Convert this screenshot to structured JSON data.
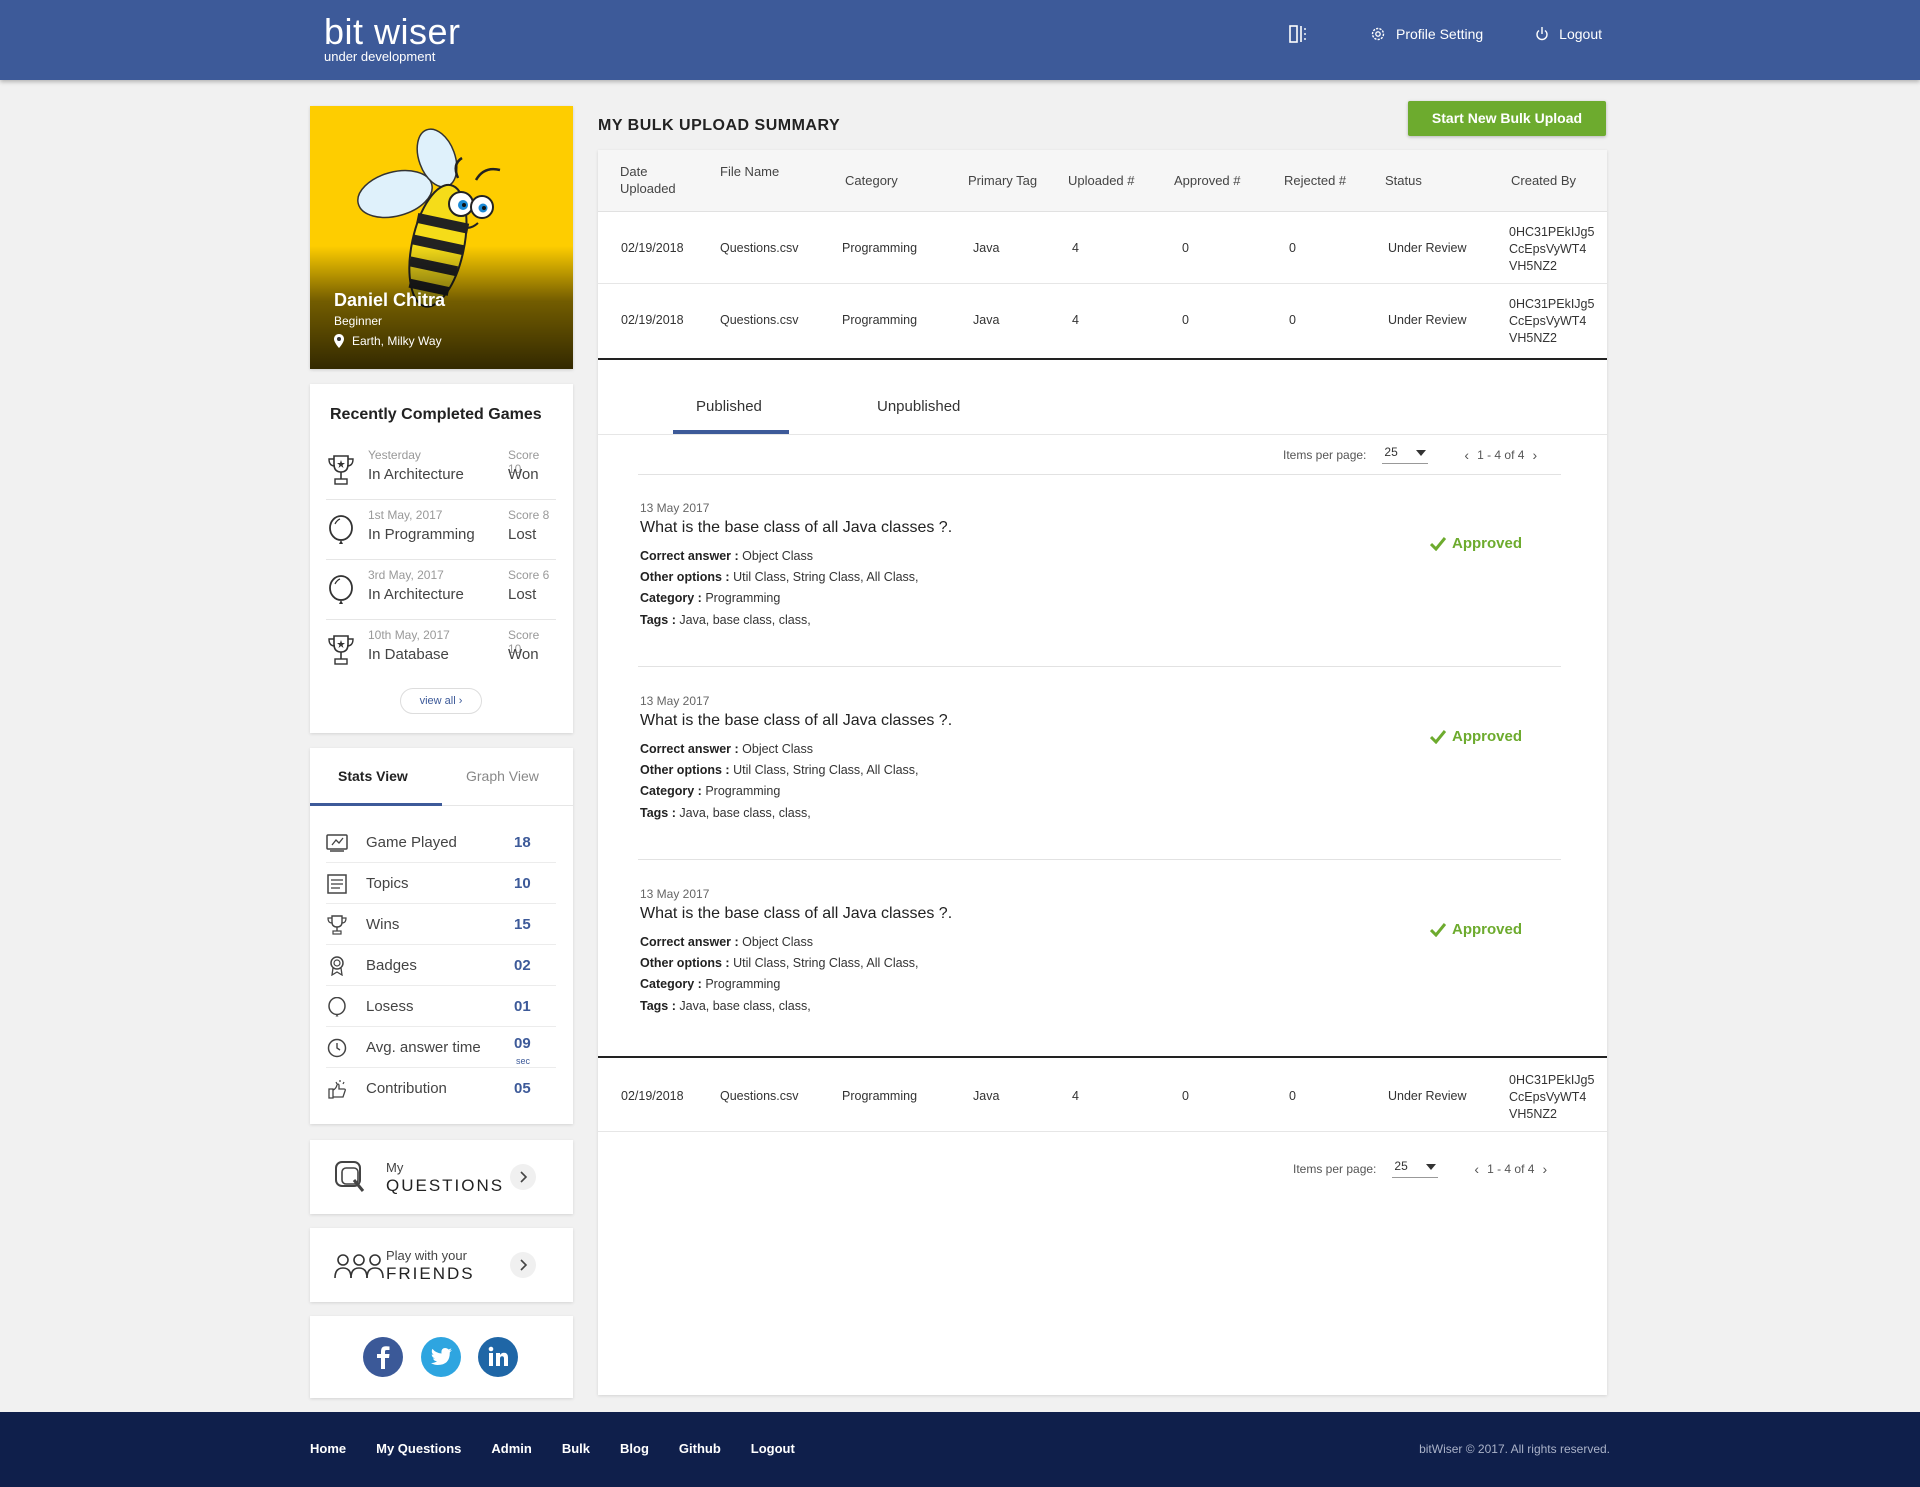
{
  "header": {
    "brand": "bit wiser",
    "brand_sub": "under development",
    "profile_setting": "Profile Setting",
    "logout": "Logout"
  },
  "profile": {
    "name": "Daniel Chitra",
    "level": "Beginner",
    "location": "Earth, Milky Way"
  },
  "recent_games": {
    "title": "Recently Completed Games",
    "items": [
      {
        "date": "Yesterday",
        "category": "In Architecture",
        "score": "Score 10",
        "result": "Won",
        "icon": "trophy-icon"
      },
      {
        "date": "1st May, 2017",
        "category": "In Programming",
        "score": "Score 8",
        "result": "Lost",
        "icon": "balloon-icon"
      },
      {
        "date": "3rd May, 2017",
        "category": "In Architecture",
        "score": "Score 6",
        "result": "Lost",
        "icon": "balloon-icon"
      },
      {
        "date": "10th May, 2017",
        "category": "In Database",
        "score": "Score 10",
        "result": "Won",
        "icon": "trophy-icon"
      }
    ],
    "view_all": "view all"
  },
  "stats": {
    "tab_stats": "Stats View",
    "tab_graph": "Graph View",
    "items": [
      {
        "label": "Game Played",
        "value": "18",
        "icon": "game-played-icon"
      },
      {
        "label": "Topics",
        "value": "10",
        "icon": "topics-icon"
      },
      {
        "label": "Wins",
        "value": "15",
        "icon": "trophy-icon"
      },
      {
        "label": "Badges",
        "value": "02",
        "icon": "badge-icon"
      },
      {
        "label": "Losess",
        "value": "01",
        "icon": "balloon-icon"
      },
      {
        "label": "Avg. answer time",
        "value": "09",
        "unit": "sec",
        "icon": "clock-icon"
      },
      {
        "label": "Contribution",
        "value": "05",
        "icon": "contribution-icon"
      }
    ]
  },
  "links": {
    "questions_small": "My",
    "questions_big": "QUESTIONS",
    "friends_small": "Play with your",
    "friends_big": "FRIENDS"
  },
  "main": {
    "title": "MY BULK UPLOAD SUMMARY",
    "new_button": "Start New Bulk Upload",
    "columns": [
      "Date Uploaded",
      "File Name",
      "Category",
      "Primary Tag",
      "Uploaded #",
      "Approved #",
      "Rejected #",
      "Status",
      "Created By"
    ],
    "rows": [
      {
        "date": "02/19/2018",
        "file": "Questions.csv",
        "category": "Programming",
        "tag": "Java",
        "uploaded": "4",
        "approved": "0",
        "rejected": "0",
        "status": "Under Review",
        "created_1": "0HC31PEkIJg5",
        "created_2": "CcEpsVyWT4",
        "created_3": "VH5NZ2"
      },
      {
        "date": "02/19/2018",
        "file": "Questions.csv",
        "category": "Programming",
        "tag": "Java",
        "uploaded": "4",
        "approved": "0",
        "rejected": "0",
        "status": "Under Review",
        "created_1": "0HC31PEkIJg5",
        "created_2": "CcEpsVyWT4",
        "created_3": "VH5NZ2"
      },
      {
        "date": "02/19/2018",
        "file": "Questions.csv",
        "category": "Programming",
        "tag": "Java",
        "uploaded": "4",
        "approved": "0",
        "rejected": "0",
        "status": "Under Review",
        "created_1": "0HC31PEkIJg5",
        "created_2": "CcEpsVyWT4",
        "created_3": "VH5NZ2"
      }
    ],
    "tab_published": "Published",
    "tab_unpublished": "Unpublished",
    "pager": {
      "label": "Items per page:",
      "per_page": "25",
      "range": "1 - 4 of 4"
    },
    "questions": [
      {
        "date": "13 May 2017",
        "title": "What is the base class of all Java classes ?.",
        "correct_label": "Correct answer :",
        "correct": "Object Class",
        "other_label": "Other options :",
        "other": "Util Class, String Class, All Class,",
        "category_label": "Category :",
        "category": "Programming",
        "tags_label": "Tags :",
        "tags": "Java, base class, class,",
        "status": "Approved"
      },
      {
        "date": "13 May 2017",
        "title": "What is the base class of all Java classes ?.",
        "correct_label": "Correct answer :",
        "correct": "Object Class",
        "other_label": "Other options :",
        "other": "Util Class, String Class, All Class,",
        "category_label": "Category :",
        "category": "Programming",
        "tags_label": "Tags :",
        "tags": "Java, base class, class,",
        "status": "Approved"
      },
      {
        "date": "13 May 2017",
        "title": "What is the base class of all Java classes ?.",
        "correct_label": "Correct answer :",
        "correct": "Object Class",
        "other_label": "Other options :",
        "other": "Util Class, String Class, All Class,",
        "category_label": "Category :",
        "category": "Programming",
        "tags_label": "Tags :",
        "tags": "Java, base class, class,",
        "status": "Approved"
      }
    ]
  },
  "footer": {
    "links": [
      "Home",
      "My Questions",
      "Admin",
      "Bulk",
      "Blog",
      "Github",
      "Logout"
    ],
    "copyright": "bitWiser © 2017. All rights reserved."
  },
  "colors": {
    "header_bg": "#3d5a99",
    "footer_bg": "#0f1f4b",
    "accent_green": "#6dab2e",
    "profile_bg": "#fecd00"
  }
}
